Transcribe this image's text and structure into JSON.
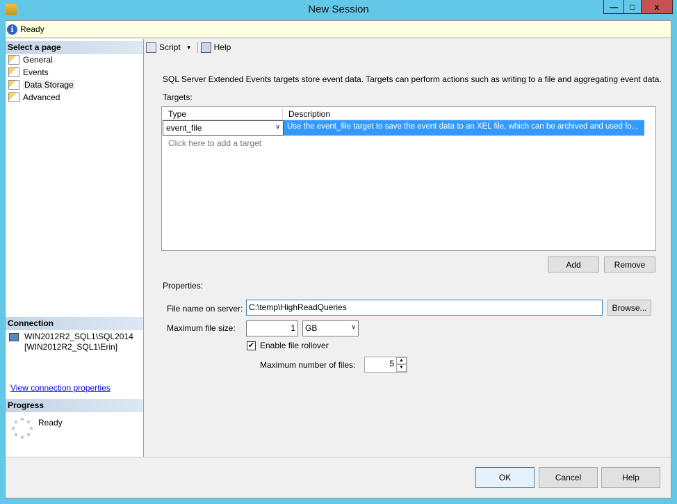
{
  "window": {
    "title": "New Session",
    "minimize": "—",
    "maximize": "□",
    "close": "x"
  },
  "status": {
    "text": "Ready"
  },
  "sidebar": {
    "select_header": "Select a page",
    "pages": [
      {
        "label": "General"
      },
      {
        "label": "Events"
      },
      {
        "label": "Data Storage",
        "selected": true
      },
      {
        "label": "Advanced"
      }
    ],
    "connection_header": "Connection",
    "server": "WIN2012R2_SQL1\\SQL2014",
    "user": "[WIN2012R2_SQL1\\Erin]",
    "view_connection": "View connection properties",
    "progress_header": "Progress",
    "progress_status": "Ready"
  },
  "toolbar": {
    "script": "Script",
    "help": "Help"
  },
  "main": {
    "intro": "SQL Server Extended Events targets store event data. Targets can perform actions such as writing to a file and aggregating event data.",
    "targets_label": "Targets:",
    "columns": [
      "Type",
      "Description"
    ],
    "rows": [
      {
        "type": "event_file",
        "description": "Use the event_file target to save the event data to an XEL file, which can be archived and used fo..."
      }
    ],
    "add_placeholder": "Click here to add a target",
    "add": "Add",
    "remove": "Remove",
    "properties_label": "Properties:",
    "file_name_label": "File name on server:",
    "file_name": "C:\\temp\\HighReadQueries",
    "browse": "Browse...",
    "max_size_label": "Maximum file size:",
    "max_size": "1",
    "size_unit": "GB",
    "rollover_label": "Enable file rollover",
    "rollover_checked": true,
    "max_files_label": "Maximum number of files:",
    "max_files": "5"
  },
  "footer": {
    "ok": "OK",
    "cancel": "Cancel",
    "help": "Help"
  },
  "colors": {
    "selection": "#3399ff",
    "frame": "#63c8e8",
    "close": "#c75050"
  }
}
